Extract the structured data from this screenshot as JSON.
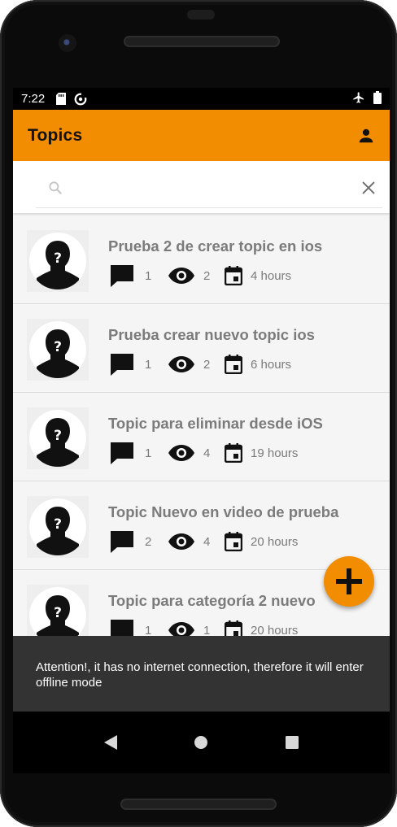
{
  "status_bar": {
    "time": "7:22",
    "icons": [
      "sd-card-icon",
      "sync-icon",
      "airplane-mode-icon",
      "battery-icon"
    ]
  },
  "app_bar": {
    "title": "Topics",
    "account_icon": "account-icon",
    "background_color": "#f28c00"
  },
  "search": {
    "placeholder": "",
    "value": "",
    "search_icon": "search-icon",
    "clear_icon": "close-icon"
  },
  "topics": [
    {
      "title": "Prueba 2 de crear topic en ios",
      "comments": "1",
      "views": "2",
      "date": "4 hours"
    },
    {
      "title": "Prueba crear nuevo topic ios",
      "comments": "1",
      "views": "2",
      "date": "6 hours"
    },
    {
      "title": "Topic para eliminar desde iOS",
      "comments": "1",
      "views": "4",
      "date": "19 hours"
    },
    {
      "title": "Topic Nuevo en video de prueba",
      "comments": "2",
      "views": "4",
      "date": "20 hours"
    },
    {
      "title": "Topic para categoría 2 nuevo",
      "comments": "1",
      "views": "1",
      "date": "20 hours"
    }
  ],
  "fab": {
    "icon": "plus-icon",
    "color": "#f28c00"
  },
  "snackbar": {
    "message": "Attention!, it has no internet connection, therefore it will enter offline mode"
  },
  "nav_bar": {
    "icons": [
      "back-icon",
      "home-icon",
      "recents-icon"
    ]
  }
}
